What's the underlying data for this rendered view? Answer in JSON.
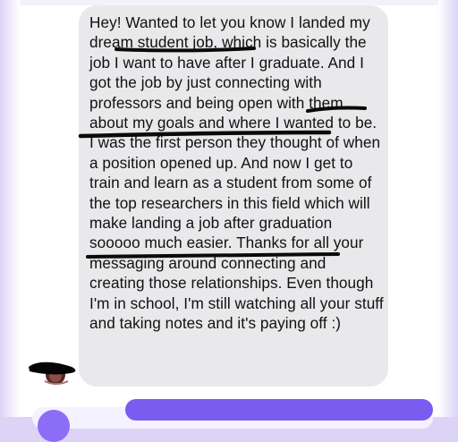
{
  "conversation": {
    "message_text": "Hey! Wanted to let you know I landed my dream student job, which is basically the job I want to have after I graduate. And I got the job by just connecting with professors and being open with them about my goals and where I wanted to be. I was the first person they thought of when a position opened up. And now I get to train and learn as a student from some of the top researchers in this field which will make landing a job after graduation sooooo much easier. Thanks for all your messaging around connecting and creating those relationships. Even though I'm in school, I'm still watching all your stuff and taking notes and it's paying off :)"
  },
  "colors": {
    "received_bubble": "#e9e9eb",
    "accent": "#7a5cf0",
    "background_tint": "#dcd3f7"
  },
  "icons": {
    "avatar": "avatar-redacted"
  }
}
